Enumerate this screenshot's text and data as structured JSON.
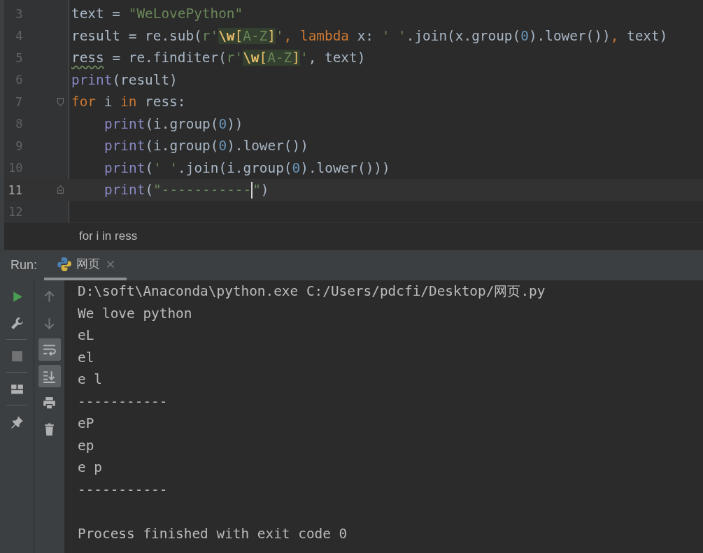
{
  "editor": {
    "lines": [
      {
        "number": "3",
        "current": false,
        "fold_open": false,
        "fold_close": false,
        "indent": false,
        "tokens": [
          {
            "text": "text = ",
            "kind": "plain"
          },
          {
            "text": "\"WeLovePython\"",
            "kind": "string"
          }
        ]
      },
      {
        "number": "4",
        "current": false,
        "fold_open": false,
        "fold_close": false,
        "indent": false,
        "tokens": [
          {
            "text": "result = re.sub(",
            "kind": "plain"
          },
          {
            "text": "r'",
            "kind": "string"
          },
          {
            "text": "\\w",
            "kind": "escape"
          },
          {
            "text": "[",
            "kind": "bracket"
          },
          {
            "text": "A-Z",
            "kind": "range"
          },
          {
            "text": "]",
            "kind": "bracket"
          },
          {
            "text": "'",
            "kind": "string"
          },
          {
            "text": ", lambda",
            "kind": "keyword"
          },
          {
            "text": " x: ",
            "kind": "plain"
          },
          {
            "text": "' '",
            "kind": "string"
          },
          {
            "text": ".join(x.group(",
            "kind": "plain"
          },
          {
            "text": "0",
            "kind": "number"
          },
          {
            "text": ").lower())",
            "kind": "plain"
          },
          {
            "text": ",",
            "kind": "keyword"
          },
          {
            "text": " text)",
            "kind": "plain"
          }
        ]
      },
      {
        "number": "5",
        "current": false,
        "fold_open": false,
        "fold_close": false,
        "indent": false,
        "tokens": [
          {
            "text": "ress",
            "kind": "warning"
          },
          {
            "text": " = re.finditer(",
            "kind": "plain"
          },
          {
            "text": "r'",
            "kind": "string"
          },
          {
            "text": "\\w",
            "kind": "escape"
          },
          {
            "text": "[",
            "kind": "bracket"
          },
          {
            "text": "A-Z",
            "kind": "range"
          },
          {
            "text": "]",
            "kind": "bracket"
          },
          {
            "text": "'",
            "kind": "string"
          },
          {
            "text": ", text)",
            "kind": "plain"
          }
        ]
      },
      {
        "number": "6",
        "current": false,
        "fold_open": false,
        "fold_close": false,
        "indent": false,
        "tokens": [
          {
            "text": "print",
            "kind": "builtin"
          },
          {
            "text": "(result)",
            "kind": "plain"
          }
        ]
      },
      {
        "number": "7",
        "current": false,
        "fold_open": true,
        "fold_close": false,
        "indent": false,
        "tokens": [
          {
            "text": "for",
            "kind": "keyword"
          },
          {
            "text": " i ",
            "kind": "plain"
          },
          {
            "text": "in",
            "kind": "keyword"
          },
          {
            "text": " ress:",
            "kind": "plain"
          }
        ]
      },
      {
        "number": "8",
        "current": false,
        "fold_open": false,
        "fold_close": false,
        "indent": true,
        "tokens": [
          {
            "text": "print",
            "kind": "builtin"
          },
          {
            "text": "(i.group(",
            "kind": "plain"
          },
          {
            "text": "0",
            "kind": "number"
          },
          {
            "text": "))",
            "kind": "plain"
          }
        ]
      },
      {
        "number": "9",
        "current": false,
        "fold_open": false,
        "fold_close": false,
        "indent": true,
        "tokens": [
          {
            "text": "print",
            "kind": "builtin"
          },
          {
            "text": "(i.group(",
            "kind": "plain"
          },
          {
            "text": "0",
            "kind": "number"
          },
          {
            "text": ").lower())",
            "kind": "plain"
          }
        ]
      },
      {
        "number": "10",
        "current": false,
        "fold_open": false,
        "fold_close": false,
        "indent": true,
        "tokens": [
          {
            "text": "print",
            "kind": "builtin"
          },
          {
            "text": "(",
            "kind": "plain"
          },
          {
            "text": "' '",
            "kind": "string"
          },
          {
            "text": ".join(i.group(",
            "kind": "plain"
          },
          {
            "text": "0",
            "kind": "number"
          },
          {
            "text": ").lower()))",
            "kind": "plain"
          }
        ]
      },
      {
        "number": "11",
        "current": true,
        "fold_open": false,
        "fold_close": true,
        "indent": true,
        "tokens": [
          {
            "text": "print",
            "kind": "builtin"
          },
          {
            "text": "(",
            "kind": "plain"
          },
          {
            "text": "\"-----------",
            "kind": "string",
            "caret_after": true
          },
          {
            "text": "\"",
            "kind": "string"
          },
          {
            "text": ")",
            "kind": "plain"
          }
        ]
      },
      {
        "number": "12",
        "current": false,
        "fold_open": false,
        "fold_close": false
      }
    ]
  },
  "breadcrumb": "for i in ress",
  "run_panel": {
    "label": "Run:",
    "tabs": [
      {
        "label": "网页",
        "selected": true,
        "closable": true
      }
    ],
    "toolbar_main": [
      {
        "kind": "run",
        "disabled": false
      },
      {
        "kind": "wrench",
        "disabled": false
      },
      {
        "kind": "separator"
      },
      {
        "kind": "stop",
        "disabled": true
      },
      {
        "kind": "separator"
      },
      {
        "kind": "layout",
        "disabled": false
      },
      {
        "kind": "separator"
      },
      {
        "kind": "pin",
        "disabled": false
      }
    ],
    "toolbar_side": [
      {
        "kind": "up",
        "disabled": true,
        "on": false
      },
      {
        "kind": "down",
        "disabled": true,
        "on": false
      },
      {
        "kind": "wrap",
        "disabled": false,
        "on": true
      },
      {
        "kind": "scroll",
        "disabled": false,
        "on": true
      },
      {
        "kind": "print",
        "disabled": false,
        "on": false
      },
      {
        "kind": "trash",
        "disabled": false,
        "on": false
      }
    ],
    "console": {
      "lines": [
        "D:\\soft\\Anaconda\\python.exe C:/Users/pdcfi/Desktop/网页.py",
        "We love python",
        "eL",
        "el",
        "e l",
        "-----------",
        "eP",
        "ep",
        "e p",
        "-----------"
      ],
      "footer": "Process finished with exit code 0"
    }
  }
}
